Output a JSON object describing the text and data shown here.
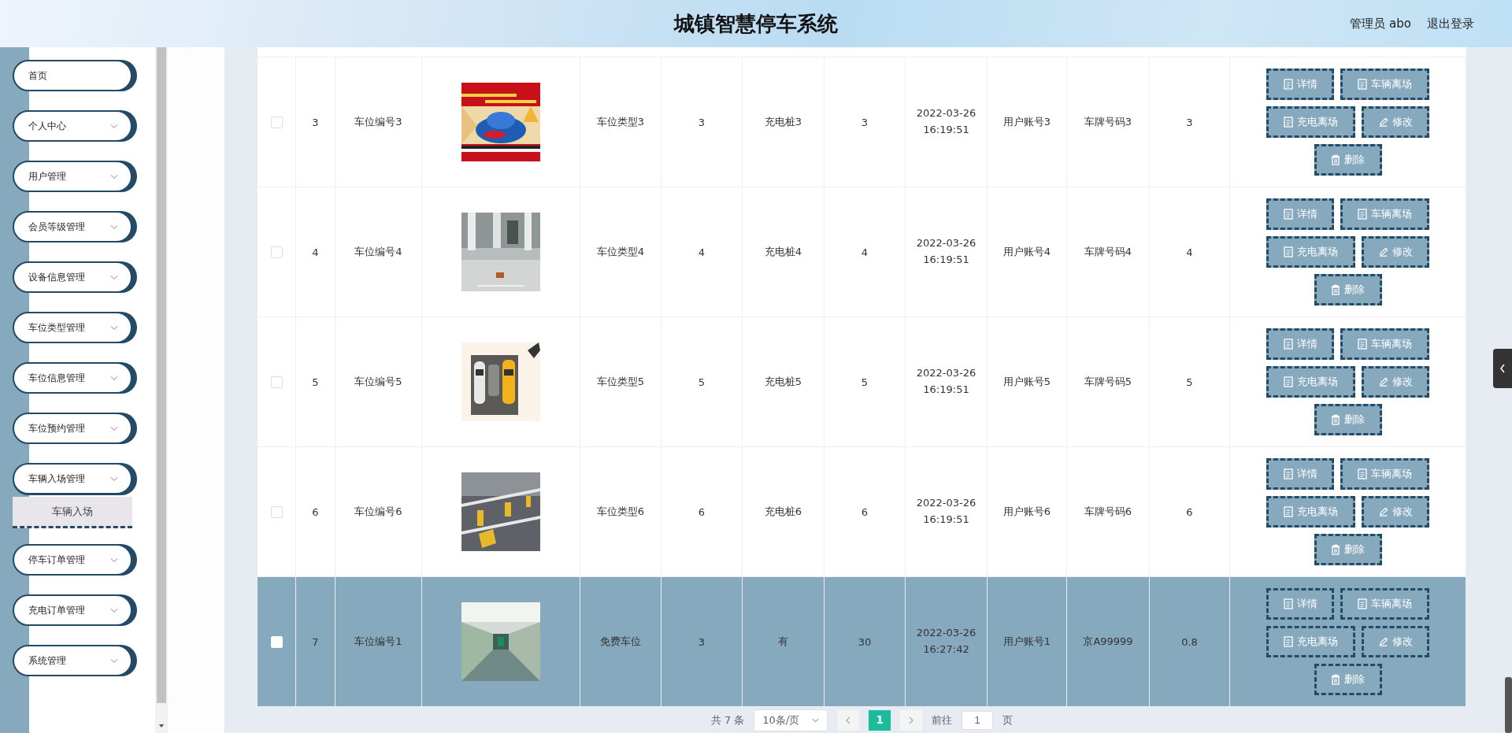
{
  "header": {
    "title": "城镇智慧停车系统",
    "user": "管理员 abo",
    "logout": "退出登录"
  },
  "sidebar": {
    "items": [
      {
        "label": "首页",
        "submenu": false,
        "expanded": false
      },
      {
        "label": "个人中心",
        "submenu": true,
        "expanded": false
      },
      {
        "label": "用户管理",
        "submenu": true,
        "expanded": false
      },
      {
        "label": "会员等级管理",
        "submenu": true,
        "expanded": false
      },
      {
        "label": "设备信息管理",
        "submenu": true,
        "expanded": false
      },
      {
        "label": "车位类型管理",
        "submenu": true,
        "expanded": false
      },
      {
        "label": "车位信息管理",
        "submenu": true,
        "expanded": false
      },
      {
        "label": "车位预约管理",
        "submenu": true,
        "expanded": false
      },
      {
        "label": "车辆入场管理",
        "submenu": true,
        "expanded": true,
        "children": [
          {
            "label": "车辆入场",
            "selected": true
          }
        ]
      },
      {
        "label": "停车订单管理",
        "submenu": true,
        "expanded": false
      },
      {
        "label": "充电订单管理",
        "submenu": true,
        "expanded": false
      },
      {
        "label": "系统管理",
        "submenu": true,
        "expanded": false
      }
    ]
  },
  "table": {
    "rows": [
      {
        "checked": false,
        "highlighted": false,
        "index": "3",
        "space_no": "车位编号3",
        "space_type": "车位类型3",
        "column_6": "3",
        "charging_pile": "充电桩3",
        "column_8": "3",
        "time": "2022-03-26 16:19:51",
        "user_account": "用户账号3",
        "plate_no": "车牌号码3",
        "column_12": "3",
        "actions": [
          {
            "label": "详情"
          },
          {
            "label": "车辆离场"
          },
          {
            "label": "充电离场"
          },
          {
            "label": "修改"
          },
          {
            "label": "删除"
          }
        ]
      },
      {
        "checked": false,
        "highlighted": false,
        "index": "4",
        "space_no": "车位编号4",
        "space_type": "车位类型4",
        "column_6": "4",
        "charging_pile": "充电桩4",
        "column_8": "4",
        "time": "2022-03-26 16:19:51",
        "user_account": "用户账号4",
        "plate_no": "车牌号码4",
        "column_12": "4",
        "actions": [
          {
            "label": "详情"
          },
          {
            "label": "车辆离场"
          },
          {
            "label": "充电离场"
          },
          {
            "label": "修改"
          },
          {
            "label": "删除"
          }
        ]
      },
      {
        "checked": false,
        "highlighted": false,
        "index": "5",
        "space_no": "车位编号5",
        "space_type": "车位类型5",
        "column_6": "5",
        "charging_pile": "充电桩5",
        "column_8": "5",
        "time": "2022-03-26 16:19:51",
        "user_account": "用户账号5",
        "plate_no": "车牌号码5",
        "column_12": "5",
        "actions": [
          {
            "label": "详情"
          },
          {
            "label": "车辆离场"
          },
          {
            "label": "充电离场"
          },
          {
            "label": "修改"
          },
          {
            "label": "删除"
          }
        ]
      },
      {
        "checked": false,
        "highlighted": false,
        "index": "6",
        "space_no": "车位编号6",
        "space_type": "车位类型6",
        "column_6": "6",
        "charging_pile": "充电桩6",
        "column_8": "6",
        "time": "2022-03-26 16:19:51",
        "user_account": "用户账号6",
        "plate_no": "车牌号码6",
        "column_12": "6",
        "actions": [
          {
            "label": "详情"
          },
          {
            "label": "车辆离场"
          },
          {
            "label": "充电离场"
          },
          {
            "label": "修改"
          },
          {
            "label": "删除"
          }
        ]
      },
      {
        "checked": false,
        "highlighted": true,
        "index": "7",
        "space_no": "车位编号1",
        "space_type": "免费车位",
        "column_6": "3",
        "charging_pile": "有",
        "column_8": "30",
        "time": "2022-03-26 16:27:42",
        "user_account": "用户账号1",
        "plate_no": "京A99999",
        "column_12": "0.8",
        "actions": [
          {
            "label": "详情"
          },
          {
            "label": "车辆离场"
          },
          {
            "label": "充电离场"
          },
          {
            "label": "修改"
          },
          {
            "label": "删除"
          }
        ]
      }
    ]
  },
  "pagination": {
    "total": "共 7 条",
    "page_size": "10条/页",
    "pages": [
      {
        "label": "1",
        "selected": true
      }
    ],
    "goto_label": "前往",
    "goto_value": "1",
    "goto_suffix": "页"
  }
}
